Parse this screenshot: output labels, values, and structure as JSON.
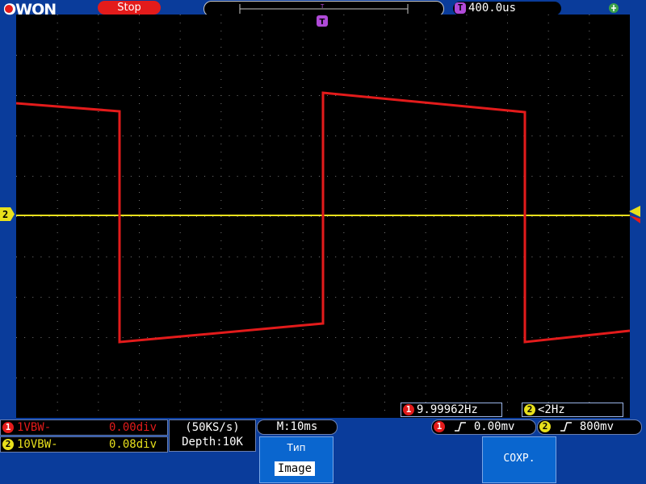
{
  "header": {
    "logo_text": "OWON",
    "run_state": "Stop",
    "timebase": "400.0us"
  },
  "measurements": {
    "ch1_freq": "9.99962Hz",
    "ch2_freq": "<2Hz"
  },
  "channels": {
    "ch1_status_left": "1VBW-",
    "ch1_status_right": "0.00div",
    "ch2_status_left": "10VBW-",
    "ch2_status_right": "0.08div",
    "ch1_badge": "1",
    "ch2_badge": "2"
  },
  "acquisition": {
    "sample_rate": "(50KS/s)",
    "depth": "Depth:10K",
    "main_time": "M:10ms"
  },
  "trigger": {
    "ch1_level": "0.00mv",
    "ch2_level": "800mv",
    "marker_label": "T"
  },
  "softkeys": {
    "type_label": "Тип",
    "type_value": "Image",
    "compare_label": "СОХР."
  },
  "colors": {
    "ch1": "#e31b1b",
    "ch2": "#e8e01c",
    "trigger": "#b04ad8",
    "background": "#0a3c9b"
  }
}
